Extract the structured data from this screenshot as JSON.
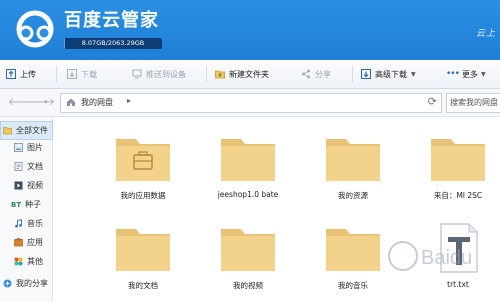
{
  "app": {
    "title": "百度云管家",
    "quota_text": "8.07GB/2063.29GB",
    "quota_fraction": 0.004,
    "corner_text": "云上"
  },
  "toolbar": {
    "upload": "上传",
    "download": "下载",
    "push_to_device": "推送到设备",
    "new_folder": "新建文件夹",
    "share": "分享",
    "advanced_download": "高级下载",
    "more": "更多"
  },
  "nav": {
    "back_icon": "back-arrow-icon",
    "forward_icon": "forward-arrow-icon",
    "breadcrumb": "我的网盘",
    "search_placeholder": "搜索我的网盘"
  },
  "sidebar": {
    "items": [
      {
        "label": "全部文件",
        "icon": "all-files-icon"
      },
      {
        "label": "图片",
        "icon": "image-icon"
      },
      {
        "label": "文档",
        "icon": "document-icon"
      },
      {
        "label": "视频",
        "icon": "video-icon"
      },
      {
        "label": "种子",
        "icon": "bt-icon"
      },
      {
        "label": "音乐",
        "icon": "music-icon"
      },
      {
        "label": "应用",
        "icon": "app-icon"
      },
      {
        "label": "其他",
        "icon": "other-icon"
      },
      {
        "label": "我的分享",
        "icon": "share-icon"
      }
    ],
    "bt_text": "BT"
  },
  "files": [
    {
      "name": "我的应用数据",
      "type": "app-folder"
    },
    {
      "name": "jeeshop1.0 bate",
      "type": "folder"
    },
    {
      "name": "我的资源",
      "type": "folder"
    },
    {
      "name": "来自：MI 2SC",
      "type": "folder"
    },
    {
      "name": "我的文档",
      "type": "folder"
    },
    {
      "name": "我的视频",
      "type": "folder"
    },
    {
      "name": "我的音乐",
      "type": "folder"
    },
    {
      "name": "trt.txt",
      "type": "text-file"
    }
  ],
  "watermark": {
    "text": "Baidu"
  },
  "colors": {
    "titlebar": "#2185e0",
    "folder": "#f3d28b",
    "folder_back": "#e9c375",
    "accent": "#1f7fd6"
  }
}
